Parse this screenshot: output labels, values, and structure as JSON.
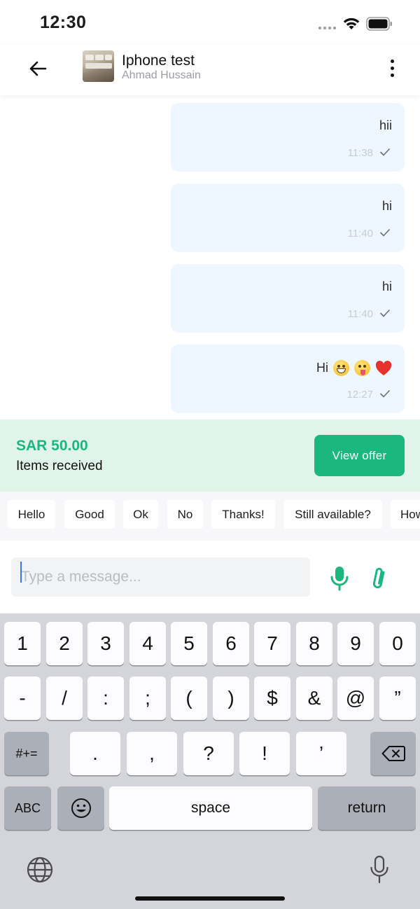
{
  "status_bar": {
    "time": "12:30"
  },
  "header": {
    "title": "Iphone test",
    "subtitle": "Ahmad Hussain"
  },
  "messages": [
    {
      "text": "hii",
      "time": "11:38",
      "status": "sent"
    },
    {
      "text": "hi",
      "time": "11:40",
      "status": "sent"
    },
    {
      "text": "hi",
      "time": "11:40",
      "status": "sent"
    },
    {
      "text": "Hi",
      "emojis": [
        "grinning-face",
        "tongue-face",
        "red-heart"
      ],
      "time": "12:27",
      "status": "sent"
    }
  ],
  "offer": {
    "price": "SAR 50.00",
    "status": "Items received",
    "button_label": "View offer"
  },
  "quick_replies": [
    "Hello",
    "Good",
    "Ok",
    "No",
    "Thanks!",
    "Still available?",
    "How"
  ],
  "composer": {
    "placeholder": "Type a message..."
  },
  "keyboard": {
    "row1": [
      "1",
      "2",
      "3",
      "4",
      "5",
      "6",
      "7",
      "8",
      "9",
      "0"
    ],
    "row2": [
      "-",
      "/",
      ":",
      ";",
      "(",
      ")",
      "$",
      "&",
      "@",
      "”"
    ],
    "row3_left": "#+=",
    "row3": [
      ".",
      ",",
      "?",
      "!",
      "’"
    ],
    "abc": "ABC",
    "space": "space",
    "return": "return"
  },
  "colors": {
    "accent": "#1cb77e",
    "bubble": "#eef7ff",
    "offer_bg": "#e0f4e9",
    "keyboard_bg": "#d3d5da"
  }
}
